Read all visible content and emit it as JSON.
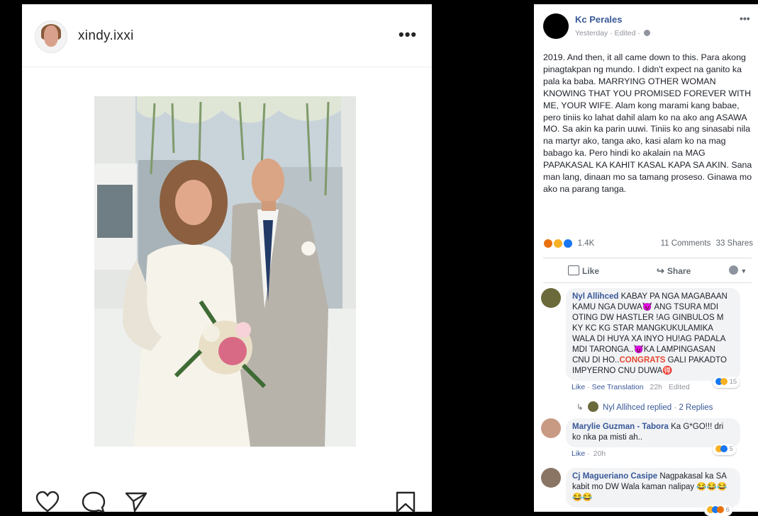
{
  "instagram": {
    "username": "xindy.ixxi",
    "more_label": "•••"
  },
  "facebook": {
    "author": "Kc Perales",
    "meta": "Yesterday · Edited ·",
    "more_label": "•••",
    "post_text": "2019. And then, it all came down to this. Para akong pinagtakpan ng mundo. I didn't expect na ganito ka pala ka baba. MARRYING OTHER WOMAN KNOWING THAT YOU PROMISED FOREVER WITH ME, YOUR WIFE. Alam kong marami kang babae, pero tiniis ko lahat dahil alam ko na ako ang ASAWA MO. Sa akin ka parin uuwi. Tiniis ko ang sinasabi nila na martyr ako, tanga ako, kasi alam ko na mag babago ka. Pero hindi ko akalain na MAG PAPAKASAL KA KAHIT KASAL KAPA SA AKIN. Sana man lang, dinaan mo sa tamang proseso. Ginawa mo ako na parang tanga.",
    "reaction_count": "1.4K",
    "comments_count": "11 Comments",
    "shares_count": "33 Shares",
    "like_label": "Like",
    "share_label": "Share",
    "colors": {
      "link": "#385898",
      "angry": "#e9710f",
      "sad": "#f7b125",
      "like": "#1877f2"
    },
    "comments": [
      {
        "author": "Nyl Allihced",
        "text_a": " KABAY PA NGA MAGABAAN KAMU NGA DUWA😈 ANG TSURA MDI OTING DW HASTLER !AG GINBULOS M KY KC KG STAR MANGKUKULAMIKA WALA DI HUYA XA INYO HU!AG PADALA MDI TARONGA..😈KA LAMPINGASAN CNU DI HO..",
        "highlight": "CONGRATS",
        "text_b": " GALI PAKADTO IMPYERNO CNU DUWA🉐",
        "like": "Like",
        "see_translation": "See Translation",
        "time": "22h",
        "edited": "Edited",
        "reactions": "15"
      },
      {
        "author": "Marylie Guzman - Tabora",
        "text": " Ka G*GO!!! dri ko nka pa misti ah..",
        "like": "Like",
        "time": "20h",
        "reactions": "5"
      },
      {
        "author": "Cj Magueriano Casipe",
        "text": " Nagpakasal ka SA kabit mo DW Wala kaman nalipay 😂😂😂 😂😂",
        "reactions": "6"
      }
    ],
    "reply": {
      "author": "Nyl Allihced replied",
      "sep": "·",
      "count": "2 Replies"
    }
  }
}
